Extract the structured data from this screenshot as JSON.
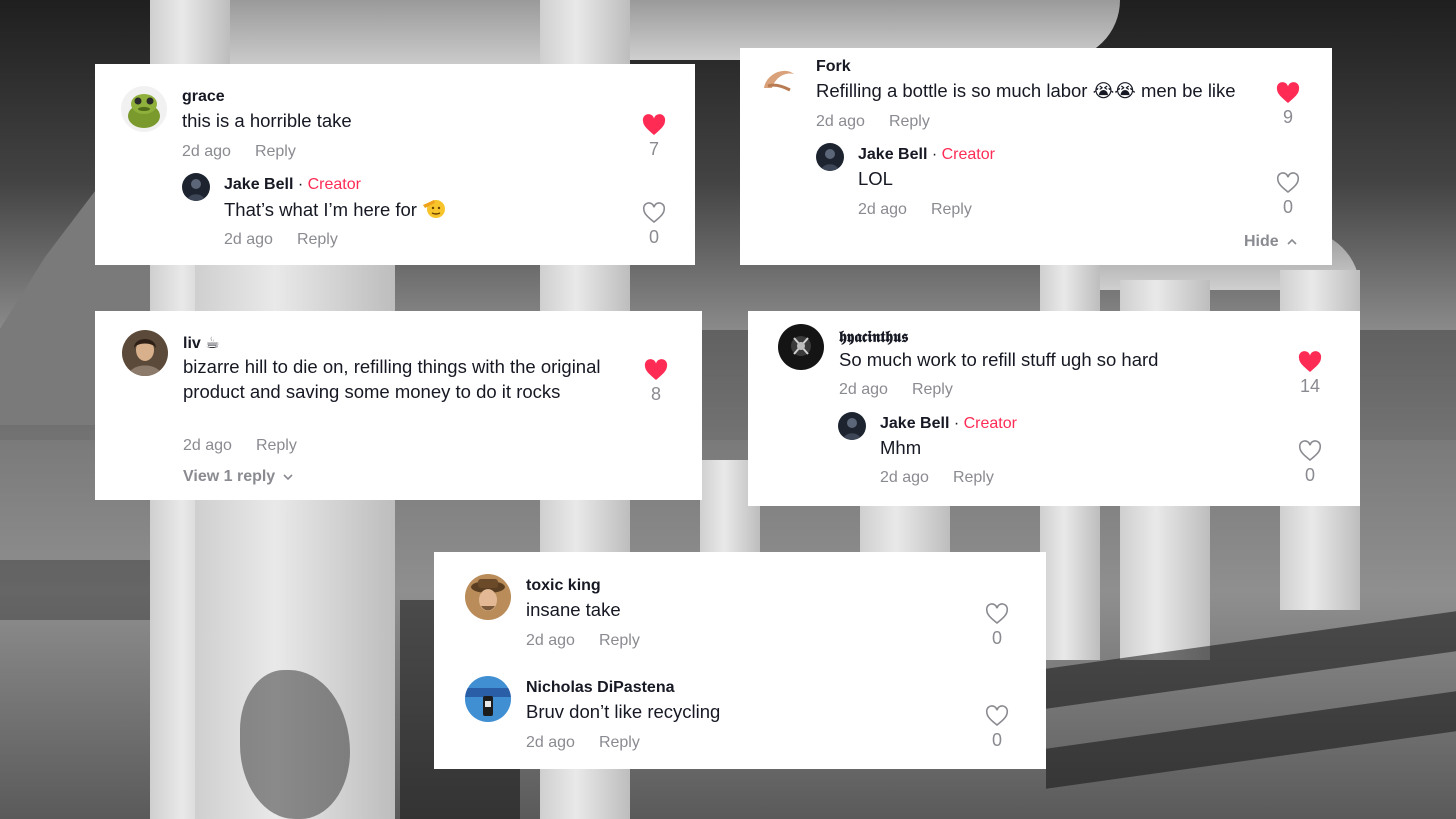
{
  "colors": {
    "accent_creator": "#fe2c55",
    "liked_heart": "#fe2c55",
    "muted_text": "#8a8b91",
    "primary_text": "#161823",
    "card_background": "#ffffff"
  },
  "cards": [
    {
      "comments": [
        {
          "username": "grace",
          "text": "this is a horrible take",
          "time": "2d ago",
          "reply_label": "Reply",
          "likes": "7",
          "liked": true,
          "avatar_icon": "green-frog-toy-avatar"
        },
        {
          "username": "Jake Bell",
          "separator": " · ",
          "badge": "Creator",
          "text": "That’s what I’m here for",
          "emoji_icon": "saluting-face-emoji",
          "time": "2d ago",
          "reply_label": "Reply",
          "likes": "0",
          "liked": false,
          "avatar_icon": "dark-portrait-avatar"
        }
      ]
    },
    {
      "comments": [
        {
          "username": "Fork",
          "text": "Refilling a bottle is so much labor 😭😭 men be like",
          "time": "2d ago",
          "reply_label": "Reply",
          "likes": "9",
          "liked": true,
          "avatar_icon": "shrimp-avatar"
        },
        {
          "username": "Jake Bell",
          "separator": " · ",
          "badge": "Creator",
          "text": "LOL",
          "time": "2d ago",
          "reply_label": "Reply",
          "likes": "0",
          "liked": false,
          "avatar_icon": "dark-portrait-avatar"
        }
      ],
      "hide_label": "Hide"
    },
    {
      "comments": [
        {
          "username": "liv ☕",
          "text": "bizarre hill to die on, refilling things with the original product and saving some money to do it rocks",
          "time": "2d ago",
          "reply_label": "Reply",
          "likes": "8",
          "liked": true,
          "avatar_icon": "woman-portrait-avatar"
        }
      ],
      "view_replies_label": "View 1 reply"
    },
    {
      "comments": [
        {
          "username": "𝖍𝖞𝖆𝖈𝖎𝖓𝖙𝖍𝖚𝖘",
          "text": "So much work to refill stuff ugh so hard",
          "time": "2d ago",
          "reply_label": "Reply",
          "likes": "14",
          "liked": true,
          "avatar_icon": "dark-figure-avatar"
        },
        {
          "username": "Jake Bell",
          "separator": " · ",
          "badge": "Creator",
          "text": "Mhm",
          "time": "2d ago",
          "reply_label": "Reply",
          "likes": "0",
          "liked": false,
          "avatar_icon": "dark-portrait-avatar"
        }
      ]
    },
    {
      "comments": [
        {
          "username": "toxic king",
          "text": "insane take",
          "time": "2d ago",
          "reply_label": "Reply",
          "likes": "0",
          "liked": false,
          "avatar_icon": "man-with-hat-avatar"
        },
        {
          "username": "Nicholas DiPastena",
          "text": "Bruv don’t like recycling",
          "time": "2d ago",
          "reply_label": "Reply",
          "likes": "0",
          "liked": false,
          "avatar_icon": "blue-perandi-avatar"
        }
      ]
    }
  ]
}
